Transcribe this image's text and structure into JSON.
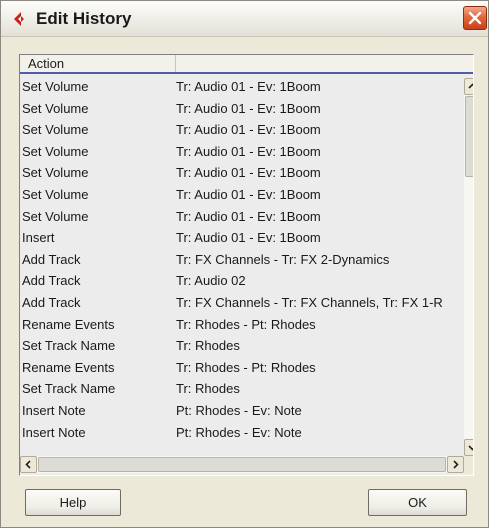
{
  "window": {
    "title": "Edit History",
    "logo_icon": "cubase-logo-icon",
    "close_icon": "close-icon",
    "colors": {
      "logo": "#c8201c",
      "close_button": "#e2683f",
      "header_underline": "#4e5ea8"
    }
  },
  "list": {
    "columns": [
      "Action",
      ""
    ],
    "rows": [
      {
        "action": "Set Volume",
        "detail": "Tr: Audio 01 - Ev: 1Boom"
      },
      {
        "action": "Set Volume",
        "detail": "Tr: Audio 01 - Ev: 1Boom"
      },
      {
        "action": "Set Volume",
        "detail": "Tr: Audio 01 - Ev: 1Boom"
      },
      {
        "action": "Set Volume",
        "detail": "Tr: Audio 01 - Ev: 1Boom"
      },
      {
        "action": "Set Volume",
        "detail": "Tr: Audio 01 - Ev: 1Boom"
      },
      {
        "action": "Set Volume",
        "detail": "Tr: Audio 01 - Ev: 1Boom"
      },
      {
        "action": "Set Volume",
        "detail": "Tr: Audio 01 - Ev: 1Boom"
      },
      {
        "action": "Insert",
        "detail": "Tr: Audio 01 - Ev: 1Boom"
      },
      {
        "action": "Add Track",
        "detail": "Tr: FX Channels - Tr: FX 2-Dynamics"
      },
      {
        "action": "Add Track",
        "detail": "Tr: Audio 02"
      },
      {
        "action": "Add Track",
        "detail": "Tr: FX Channels - Tr: FX Channels, Tr: FX 1-R"
      },
      {
        "action": "Rename Events",
        "detail": "Tr: Rhodes - Pt: Rhodes"
      },
      {
        "action": "Set Track Name",
        "detail": "Tr: Rhodes"
      },
      {
        "action": "Rename Events",
        "detail": "Tr: Rhodes - Pt: Rhodes"
      },
      {
        "action": "Set Track Name",
        "detail": "Tr: Rhodes"
      },
      {
        "action": "Insert Note",
        "detail": "Pt: Rhodes - Ev: Note"
      },
      {
        "action": "Insert Note",
        "detail": "Pt: Rhodes - Ev: Note"
      }
    ],
    "scrollbar_icons": [
      "scroll-up-arrow-icon",
      "scroll-down-arrow-icon",
      "scroll-left-arrow-icon",
      "scroll-right-arrow-icon"
    ]
  },
  "buttons": {
    "help": "Help",
    "ok": "OK"
  }
}
